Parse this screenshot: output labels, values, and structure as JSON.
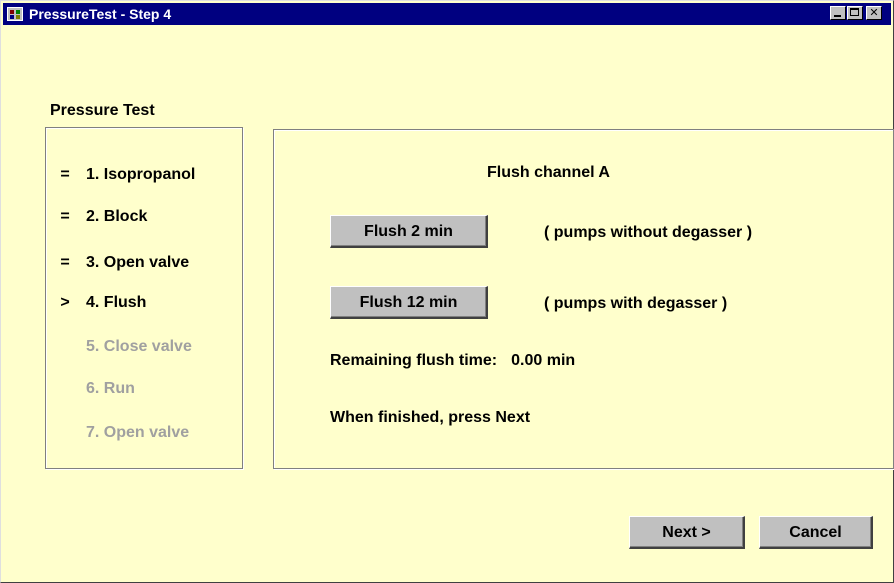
{
  "window": {
    "title": "PressureTest - Step 4",
    "controls": {
      "minimize_icon": "minimize-icon",
      "maximize_icon": "maximize-icon",
      "close_label": "✕"
    }
  },
  "sidebar": {
    "title": "Pressure Test",
    "steps": [
      {
        "marker": "=",
        "label": "1. Isopropanol",
        "state": "done"
      },
      {
        "marker": "=",
        "label": "2. Block",
        "state": "done"
      },
      {
        "marker": "=",
        "label": "3. Open valve",
        "state": "done"
      },
      {
        "marker": ">",
        "label": "4. Flush",
        "state": "current"
      },
      {
        "marker": "",
        "label": "5. Close valve",
        "state": "pending"
      },
      {
        "marker": "",
        "label": "6. Run",
        "state": "pending"
      },
      {
        "marker": "",
        "label": "7. Open valve",
        "state": "pending"
      }
    ]
  },
  "main": {
    "heading": "Flush channel A",
    "flush_short": {
      "label": "Flush 2 min",
      "note": "( pumps without degasser )"
    },
    "flush_long": {
      "label": "Flush 12 min",
      "note": "( pumps with degasser )"
    },
    "remaining_label": "Remaining flush time:",
    "remaining_value": "0.00 min",
    "instruction": "When finished, press Next"
  },
  "footer": {
    "next_label": "Next >",
    "cancel_label": "Cancel"
  },
  "colors": {
    "background": "#ffffcc",
    "titlebar": "#000080",
    "button_face": "#c0c0c0",
    "pending_text": "#a0a0a0"
  }
}
